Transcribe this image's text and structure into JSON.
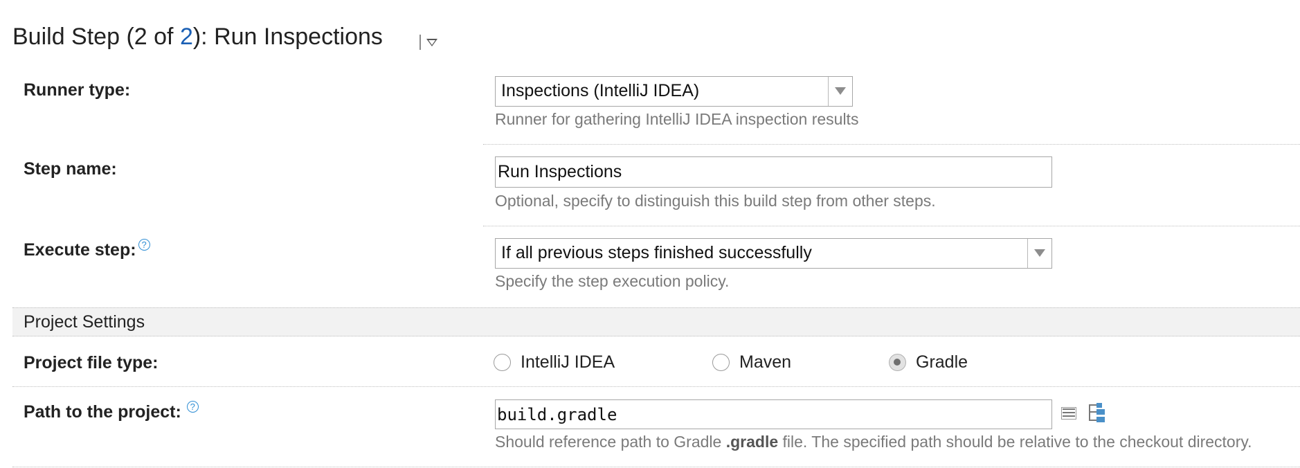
{
  "header": {
    "title_prefix": "Build Step (",
    "title_step": "2",
    "title_of": " of ",
    "title_total": "2",
    "title_suffix": "): Run Inspections"
  },
  "runner_type": {
    "label": "Runner type:",
    "value": "Inspections (IntelliJ IDEA)",
    "note": "Runner for gathering IntelliJ IDEA inspection results"
  },
  "step_name": {
    "label": "Step name:",
    "value": "Run Inspections",
    "note": "Optional, specify to distinguish this build step from other steps."
  },
  "execute_step": {
    "label": "Execute step:",
    "help": "?",
    "value": "If all previous steps finished successfully",
    "note": "Specify the step execution policy."
  },
  "project_settings": {
    "section_title": "Project Settings",
    "file_type": {
      "label": "Project file type:",
      "options": [
        "IntelliJ IDEA",
        "Maven",
        "Gradle"
      ],
      "selected": "Gradle"
    },
    "path": {
      "label": "Path to the project:",
      "help": "?",
      "value": "build.gradle",
      "note_prefix": "Should reference path to Gradle ",
      "note_bold": ".gradle",
      "note_suffix": " file. The specified path should be relative to the checkout directory."
    }
  },
  "icons": {
    "title_menu": "dropdown-menu-icon",
    "help": "help-question-icon",
    "list": "list-icon",
    "tree": "tree-browse-icon"
  },
  "colors": {
    "link": "#1a5fb4",
    "help": "#2f8ed4",
    "section_bg": "#f2f2f2",
    "note_text": "#7a7a7a"
  }
}
